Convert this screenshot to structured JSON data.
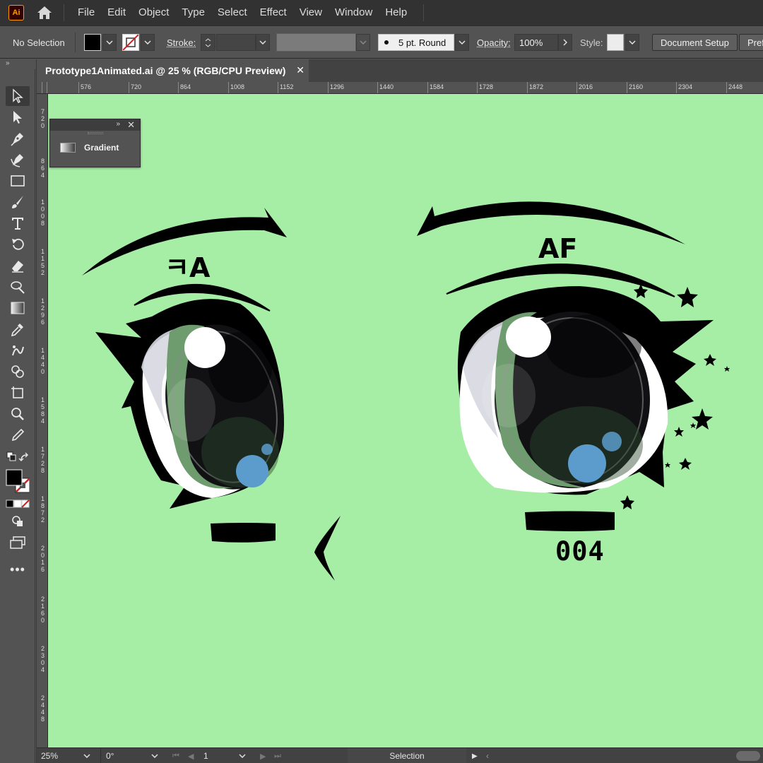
{
  "app": {
    "logo_text": "Ai",
    "menu": [
      "File",
      "Edit",
      "Object",
      "Type",
      "Select",
      "Effect",
      "View",
      "Window",
      "Help"
    ]
  },
  "control_bar": {
    "selection_status": "No Selection",
    "stroke_label": "Stroke:",
    "brush_value": "5 pt. Round",
    "opacity_label": "Opacity:",
    "opacity_value": "100%",
    "style_label": "Style:",
    "document_setup": "Document Setup",
    "preferences": "Pref"
  },
  "document_tab": {
    "title": "Prototype1Animated.ai @ 25 % (RGB/CPU Preview)",
    "close": "✕"
  },
  "rulers": {
    "horizontal": [
      "576",
      "720",
      "864",
      "1008",
      "1152",
      "1296",
      "1440",
      "1584",
      "1728",
      "1872",
      "2016",
      "2160",
      "2304",
      "2448"
    ],
    "vertical": [
      "720",
      "864",
      "1008",
      "1152",
      "1296",
      "1440",
      "1584",
      "1728",
      "1872",
      "2016",
      "2160",
      "2304",
      "2448"
    ]
  },
  "gradient_panel": {
    "title": "Gradient"
  },
  "artwork": {
    "left_brow_text": "ㅋA",
    "right_brow_text": "AF",
    "number_text": "004",
    "colors": {
      "canvas": "#a6eea6",
      "ink": "#000000",
      "iris": "#6e9c6e",
      "pupil": "#111111",
      "highlight": "#ffffff",
      "blue_spot": "#5b9ccc"
    }
  },
  "status_bar": {
    "zoom": "25%",
    "rotation": "0°",
    "artboard": "1",
    "tool": "Selection"
  }
}
